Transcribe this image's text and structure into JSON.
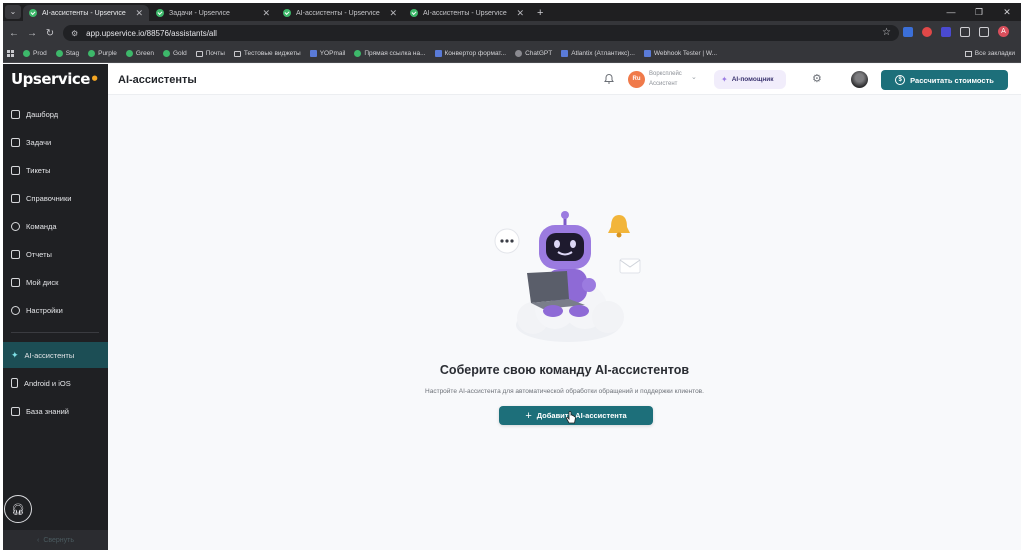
{
  "browser": {
    "tabs": [
      {
        "title": "AI-ассистенты - Upservice",
        "active": true
      },
      {
        "title": "Задачи - Upservice",
        "active": false
      },
      {
        "title": "AI-ассистенты - Upservice",
        "active": false
      },
      {
        "title": "AI-ассистенты - Upservice",
        "active": false
      }
    ],
    "url": "app.upservice.io/88576/assistants/all",
    "profile_initial": "A",
    "bookmarks": [
      "Prod",
      "Stag",
      "Purple",
      "Green",
      "Gold",
      "Почты",
      "Тестовые виджеты",
      "YOPmail",
      "Прямая ссылка на...",
      "Конвертор формат...",
      "ChatGPT",
      "Atlantix (Атлантикс)...",
      "Webhook Tester | W..."
    ],
    "bookmarks_right": "Все закладки"
  },
  "sidebar": {
    "logo": "Upservice",
    "items": [
      {
        "label": "Дашборд"
      },
      {
        "label": "Задачи"
      },
      {
        "label": "Тикеты"
      },
      {
        "label": "Справочники"
      },
      {
        "label": "Команда"
      },
      {
        "label": "Отчеты"
      },
      {
        "label": "Мой диск"
      },
      {
        "label": "Настройки"
      },
      {
        "label": "AI-ассистенты",
        "active": true
      },
      {
        "label": "Android и iOS"
      },
      {
        "label": "База знаний"
      }
    ],
    "collapse_label": "Свернуть"
  },
  "header": {
    "title": "AI-ассистенты",
    "workspace_badge": "Ru",
    "workspace_name": "Ворксплейс",
    "workspace_role": "Ассистент",
    "ai_helper": "AI-помощник",
    "calc_button": "Рассчитать стоимость"
  },
  "empty_state": {
    "title": "Соберите свою команду AI-ассистентов",
    "subtitle": "Настройте AI-ассистента для автоматической обработки обращений и поддержки клиентов.",
    "button": "Добавить AI-ассистента"
  },
  "colors": {
    "accent": "#1d6f7a",
    "sidebar_bg": "#1f2023",
    "sidebar_active": "#1c4e55"
  }
}
